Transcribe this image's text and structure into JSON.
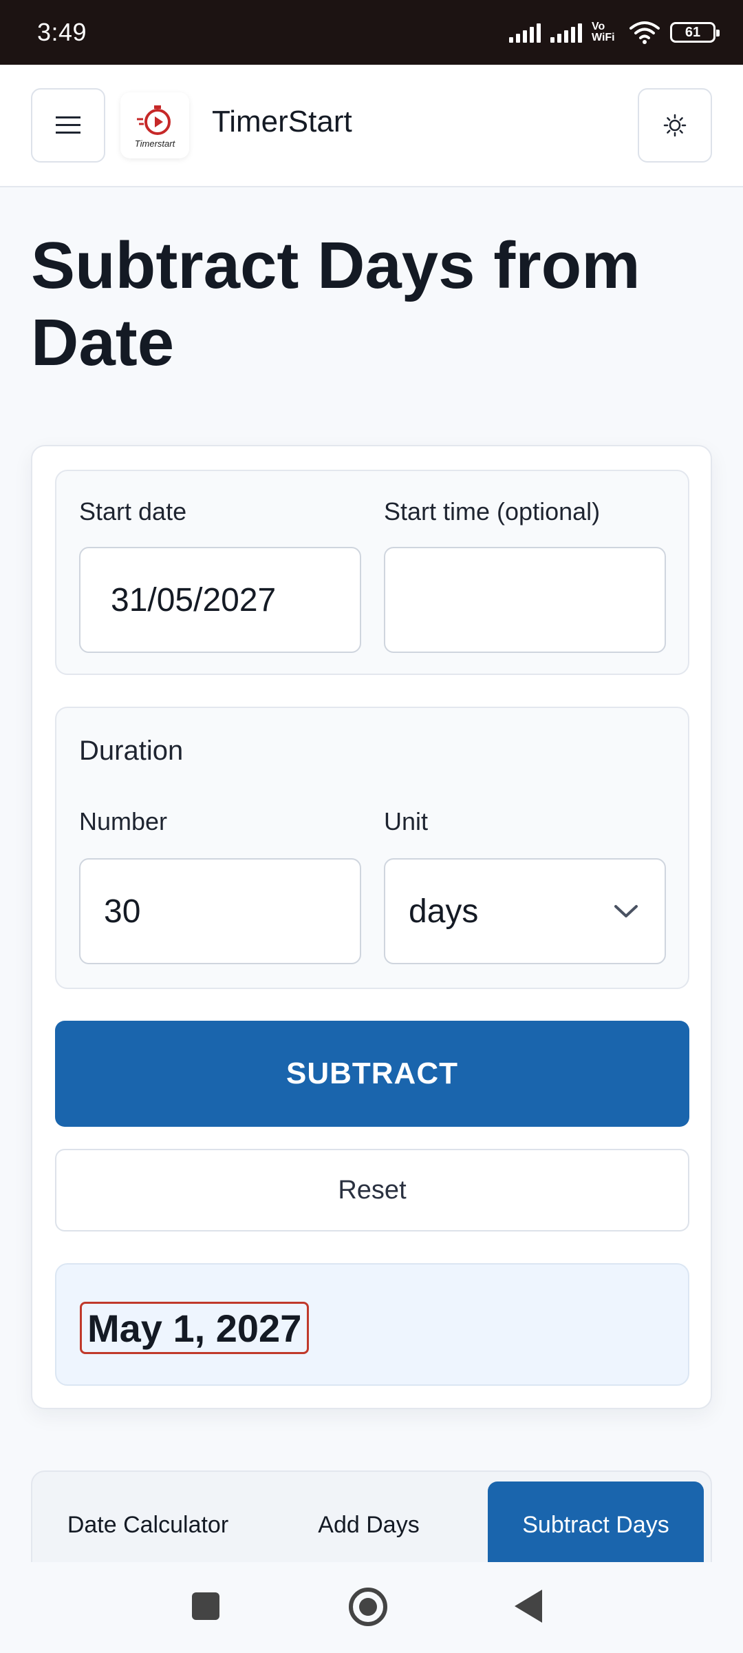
{
  "status_bar": {
    "time": "3:49",
    "network_label": "Vo WiFi",
    "battery": "61"
  },
  "header": {
    "app_name": "TimerStart",
    "logo_text": "Timerstart",
    "menu_icon": "menu-icon",
    "theme_icon": "sun-icon"
  },
  "page": {
    "title": "Subtract Days from Date"
  },
  "form": {
    "start_date_label": "Start date",
    "start_date_value": "31/05/2027",
    "start_time_label": "Start time (optional)",
    "start_time_value": "",
    "duration_label": "Duration",
    "number_label": "Number",
    "number_value": "30",
    "unit_label": "Unit",
    "unit_value": "days",
    "subtract_label": "SUBTRACT",
    "reset_label": "Reset"
  },
  "result": {
    "value": "May 1, 2027"
  },
  "tabs": [
    {
      "label": "Date Calculator",
      "active": false
    },
    {
      "label": "Add Days",
      "active": false
    },
    {
      "label": "Subtract Days",
      "active": true
    }
  ],
  "colors": {
    "accent": "#1a65ad",
    "result_bg": "#eef5fe",
    "highlight_border": "#c0392b"
  }
}
